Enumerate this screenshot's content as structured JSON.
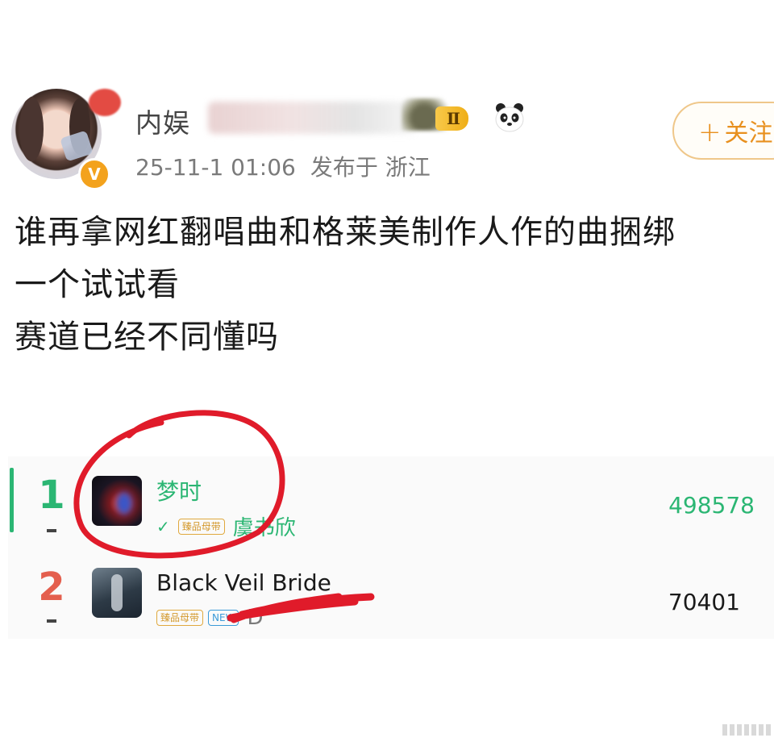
{
  "post": {
    "username": "内娱",
    "level_badge": "Ⅱ",
    "vip_badge": "V",
    "timestamp": "25-11-1 01:06",
    "location": "发布于 浙江",
    "follow_label": "关注",
    "text_lines": [
      "谁再拿网红翻唱曲和格莱美制作人作的曲捆绑",
      "一个试试看",
      "赛道已经不同懂吗"
    ]
  },
  "ranking": [
    {
      "rank": "1",
      "title": "梦时",
      "tag": "臻品母带",
      "artist": "虞书欣",
      "count": "498578",
      "rank_color": "#2bb673"
    },
    {
      "rank": "2",
      "title": "Black Veil Bride",
      "tag": "臻品母带",
      "tag_new": "NEW",
      "artist": "D",
      "count": "70401",
      "rank_color": "#e45f4e"
    }
  ],
  "icons": [
    "vip-icon",
    "level-icon",
    "panda-icon",
    "plus-icon",
    "check-icon"
  ],
  "colors": {
    "accent_green": "#2bb673",
    "follow_orange": "#e8901e",
    "annotation_red": "#e01b2a"
  }
}
